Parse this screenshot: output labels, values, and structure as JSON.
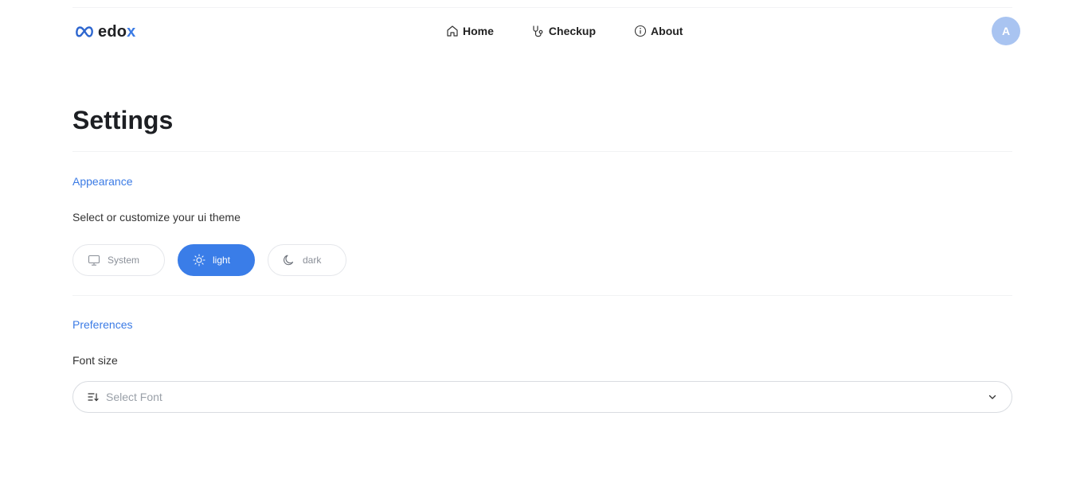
{
  "brand": {
    "logo_text_main": "edo",
    "logo_text_accent": "x"
  },
  "nav": {
    "items": [
      {
        "label": "Home",
        "icon": "home-icon"
      },
      {
        "label": "Checkup",
        "icon": "stethoscope-icon"
      },
      {
        "label": "About",
        "icon": "info-icon"
      }
    ]
  },
  "user": {
    "avatar_initial": "A"
  },
  "settings": {
    "title": "Settings",
    "appearance": {
      "section_title": "Appearance",
      "description": "Select or customize your ui theme",
      "themes": [
        {
          "label": "System",
          "icon": "monitor-icon",
          "selected": false
        },
        {
          "label": "light",
          "icon": "sun-icon",
          "selected": true
        },
        {
          "label": "dark",
          "icon": "moon-icon",
          "selected": false
        }
      ]
    },
    "preferences": {
      "section_title": "Preferences",
      "font_size_label": "Font size",
      "font_select": {
        "placeholder": "Select Font",
        "value": ""
      }
    }
  },
  "colors": {
    "accent": "#3b7be5",
    "avatar_bg": "#a9c4f1"
  }
}
